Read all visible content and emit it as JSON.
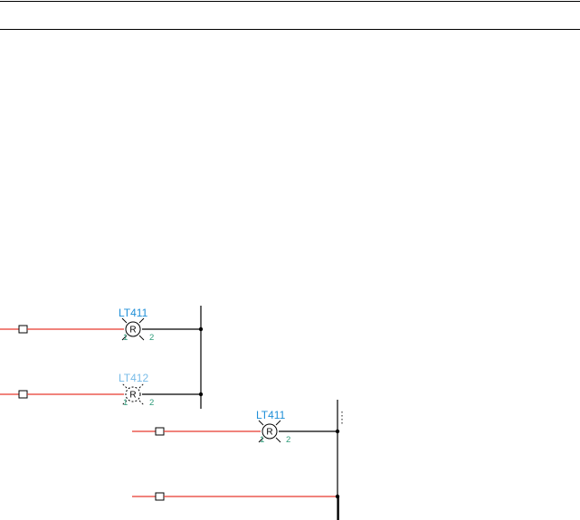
{
  "header": {},
  "lamps": [
    {
      "tag": "LT411",
      "letter": "R",
      "pin_left": "1",
      "pin_right": "2",
      "state": "normal"
    },
    {
      "tag": "LT412",
      "letter": "R",
      "pin_left": "1",
      "pin_right": "2",
      "state": "ghost"
    },
    {
      "tag": "LT411",
      "letter": "R",
      "pin_left": "1",
      "pin_right": "2",
      "state": "normal"
    }
  ],
  "colors": {
    "wire": "#e8392f",
    "tag": "#1f8fd8",
    "pin": "#2e9c7a",
    "line": "#000000"
  }
}
